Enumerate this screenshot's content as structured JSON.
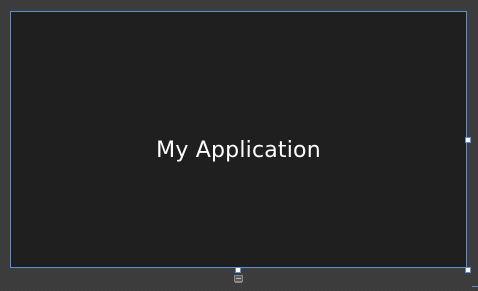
{
  "app": {
    "title": "My Application"
  },
  "colors": {
    "canvas_background": "#3c3c3c",
    "app_background": "#1f1f1f",
    "selection_border": "#5a8fd6",
    "title_text": "#ffffff"
  },
  "icons": {
    "bottom_anchor": "adorner-icon"
  }
}
